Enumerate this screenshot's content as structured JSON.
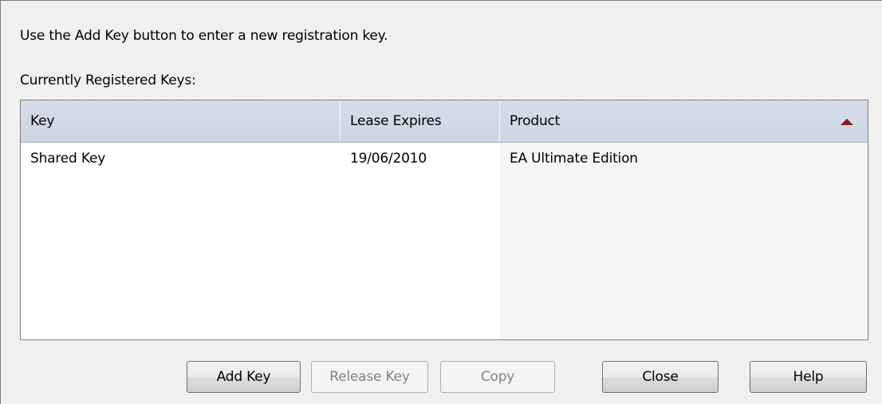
{
  "dialog": {
    "instruction": "Use the Add Key button to enter a new registration key.",
    "list_label": "Currently Registered Keys:"
  },
  "table": {
    "columns": [
      {
        "label": "Key"
      },
      {
        "label": "Lease Expires"
      },
      {
        "label": "Product",
        "sorted": "ascending"
      }
    ],
    "rows": [
      {
        "key": "Shared Key",
        "lease_expires": "19/06/2010",
        "product": "EA Ultimate Edition"
      }
    ],
    "sort_icon": "triangle-up-icon",
    "colors": {
      "sort_icon": "#8b1d1d",
      "header": "#d6dde9"
    }
  },
  "buttons": {
    "add_key": {
      "label": "Add Key",
      "enabled": true
    },
    "release_key": {
      "label": "Release Key",
      "enabled": false
    },
    "copy": {
      "label": "Copy",
      "enabled": false
    },
    "close": {
      "label": "Close",
      "enabled": true
    },
    "help": {
      "label": "Help",
      "enabled": true
    }
  }
}
